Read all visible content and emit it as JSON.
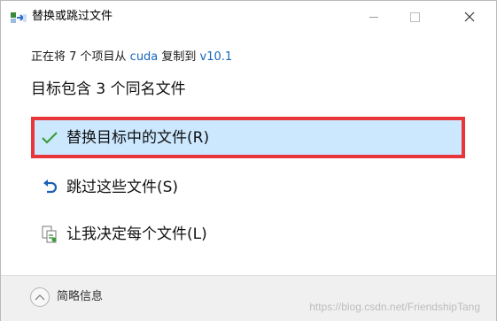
{
  "window": {
    "title": "替换或跳过文件"
  },
  "subtitle": {
    "prefix": "正在将 7 个项目从 ",
    "source": "cuda",
    "middle": " 复制到 ",
    "destination": "v10.1"
  },
  "heading": "目标包含 3 个同名文件",
  "options": [
    {
      "label": "替换目标中的文件(R)",
      "icon": "checkmark-icon",
      "selected": true
    },
    {
      "label": "跳过这些文件(S)",
      "icon": "undo-arrow-icon",
      "selected": false
    },
    {
      "label": "让我决定每个文件(L)",
      "icon": "compare-files-icon",
      "selected": false
    }
  ],
  "footer": {
    "details_label": "简略信息",
    "watermark": "https://blog.csdn.net/FriendshipTang"
  },
  "colors": {
    "selected_bg": "#cce8ff",
    "highlight_border": "#e8353a",
    "link": "#1565c0",
    "check": "#3a9d3a"
  }
}
